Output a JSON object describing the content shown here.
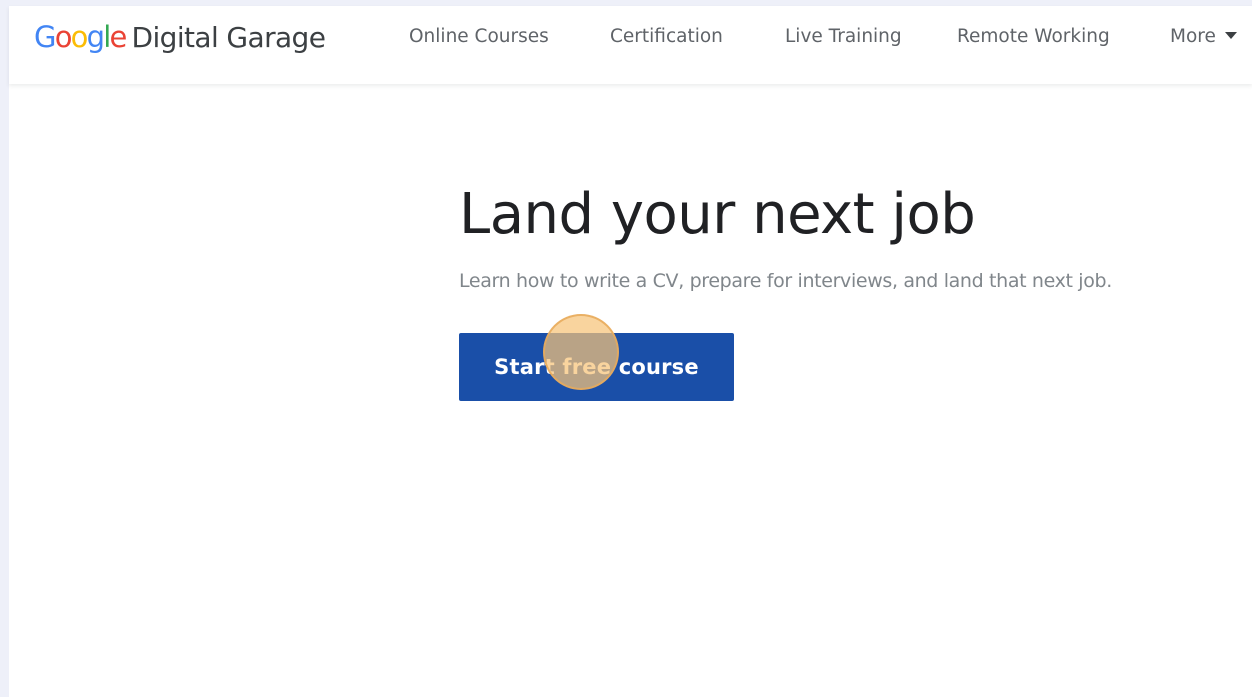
{
  "header": {
    "logo": {
      "letters": [
        {
          "char": "G",
          "color": "#4285F4"
        },
        {
          "char": "o",
          "color": "#EA4335"
        },
        {
          "char": "o",
          "color": "#FBBC05"
        },
        {
          "char": "g",
          "color": "#4285F4"
        },
        {
          "char": "l",
          "color": "#34A853"
        },
        {
          "char": "e",
          "color": "#EA4335"
        }
      ],
      "product": "Digital Garage"
    },
    "nav": [
      {
        "label": "Online Courses"
      },
      {
        "label": "Certification"
      },
      {
        "label": "Live Training"
      },
      {
        "label": "Remote Working"
      },
      {
        "label": "More",
        "icon": "caret-down-icon"
      }
    ]
  },
  "hero": {
    "title": "Land your next job",
    "subtitle": "Learn how to write a CV, prepare for interviews, and land that next job.",
    "cta_label": "Start free course"
  },
  "colors": {
    "cta_background": "#1a4fa8",
    "page_background": "#eef0f9",
    "cursor_highlight": "#f6c478"
  }
}
